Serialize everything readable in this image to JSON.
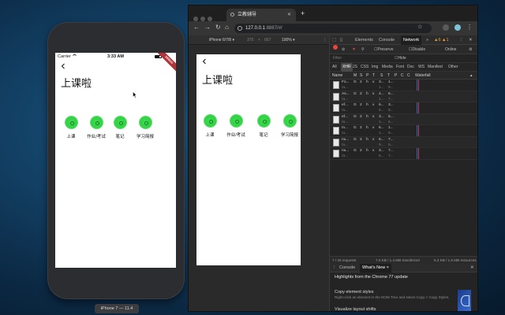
{
  "simulator": {
    "status": {
      "carrier": "Carrier",
      "time": "3:33 AM"
    },
    "debug_ribbon": "DEBUG",
    "title": "上课啦",
    "caption": "iPhone 7 — 11.4"
  },
  "tiles": [
    {
      "label": "上课"
    },
    {
      "label": "作业/考试"
    },
    {
      "label": "笔记"
    },
    {
      "label": "学习简报"
    }
  ],
  "browser": {
    "tab_title": "立教辅导",
    "url_host": "127.0.0.1",
    "url_rest": ":8887/#/",
    "device_bar": {
      "device": "iPhone 6/7/8 ▾",
      "width": "375",
      "sep": "×",
      "height": "667",
      "zoom": "100% ▾"
    }
  },
  "devtools": {
    "tabs": [
      "Elements",
      "Console",
      "Network"
    ],
    "active_tab": "Network",
    "badges": "▲6 ▲1",
    "toolbar": {
      "preserve_log": "Preserve log",
      "disable_cache": "Disable cache",
      "online": "Online"
    },
    "filter": {
      "placeholder": "Filter",
      "hide_data_urls": "Hide data URLs"
    },
    "types": [
      "All",
      "XHR",
      "JS",
      "CSS",
      "Img",
      "Media",
      "Font",
      "Doc",
      "WS",
      "Manifest",
      "Other"
    ],
    "selected_type": "XHR",
    "columns": [
      "Name",
      "M",
      "S",
      "P",
      "T",
      "S",
      "T",
      "P",
      "C",
      "C",
      "Waterfall"
    ],
    "rows": [
      {
        "name": "Fo...",
        "sub": "/a...",
        "m": "G",
        "s": "2",
        "p": "h",
        "t": "x",
        "size": "3...",
        "time": "1...",
        "sub2": "1...",
        "sub3": "9..."
      },
      {
        "name": "As...",
        "sub": "/a...",
        "m": "G",
        "s": "2",
        "p": "h",
        "t": "x",
        "size": "4...",
        "time": "6...",
        "sub2": "1...",
        "sub3": "7..."
      },
      {
        "name": "ef...",
        "sub": "/a...",
        "m": "G",
        "s": "2",
        "p": "h",
        "t": "x",
        "size": "6...",
        "time": "3...",
        "sub2": "6...",
        "sub3": "8..."
      },
      {
        "name": "ef...",
        "sub": "/a...",
        "m": "G",
        "s": "2",
        "p": "h",
        "t": "x",
        "size": "3...",
        "time": "5...",
        "sub2": "1...",
        "sub3": "6..."
      },
      {
        "name": "m...",
        "sub": "/a...",
        "m": "G",
        "s": "2",
        "p": "h",
        "t": "x",
        "size": "6...",
        "time": "1...",
        "sub2": "1...",
        "sub3": "9..."
      },
      {
        "name": "nu...",
        "sub": "/a...",
        "m": "G",
        "s": "2",
        "p": "h",
        "t": "x",
        "size": "6...",
        "time": "7...",
        "sub2": "9...",
        "sub3": "5..."
      },
      {
        "name": "nu...",
        "sub": "/a...",
        "m": "G",
        "s": "2",
        "p": "h",
        "t": "x",
        "size": "3...",
        "time": "7...",
        "sub2": "6...",
        "sub3": "7..."
      }
    ],
    "summary": {
      "requests": "7 / 25 requests",
      "transferred": "7.0 KB / 1.4 MB transferred",
      "resources": "6.3 KB / 1.6 MB resources"
    },
    "drawer_tabs": [
      "Console",
      "What's New ×"
    ],
    "drawer_active": "What's New ×",
    "drawer": {
      "highlight": "Highlights from the Chrome 77 update",
      "item1_title": "Copy element styles",
      "item1_desc": "Right-click an element in the DOM Tree and select Copy > Copy Styles.",
      "item2_title": "Visualize layout shifts"
    }
  },
  "colors": {
    "tile_green": "#32d045",
    "record_red": "#e8453c",
    "desktop_blue": "#123f63"
  }
}
